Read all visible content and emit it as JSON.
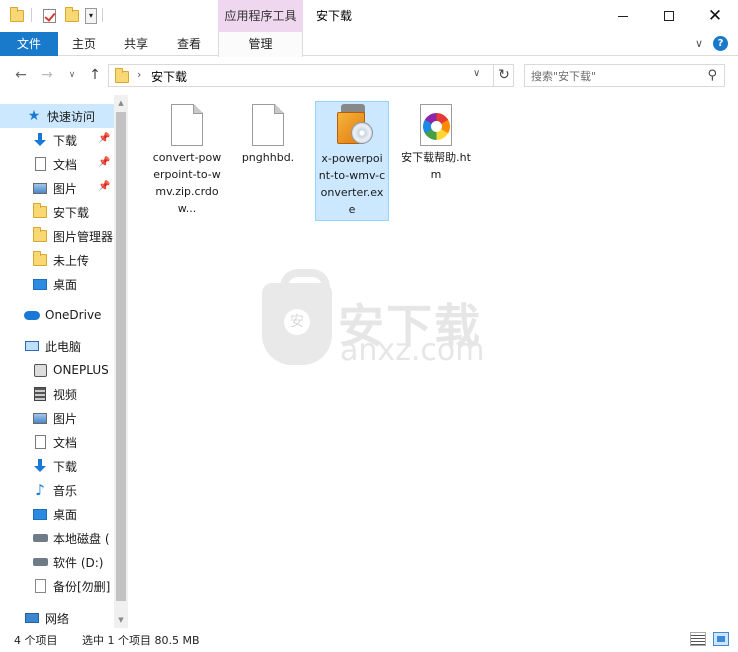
{
  "window": {
    "title": "安下载",
    "contextual_tab_group": "应用程序工具"
  },
  "ribbon": {
    "tabs": [
      {
        "label": "文件"
      },
      {
        "label": "主页"
      },
      {
        "label": "共享"
      },
      {
        "label": "查看"
      },
      {
        "label": "管理"
      }
    ]
  },
  "address": {
    "path": "安下载",
    "search_placeholder": "搜索\"安下载\""
  },
  "nav": {
    "items": [
      {
        "label": "快速访问",
        "icon": "star-icon"
      },
      {
        "label": "下载",
        "icon": "download-icon"
      },
      {
        "label": "文档",
        "icon": "document-icon"
      },
      {
        "label": "图片",
        "icon": "pictures-icon"
      },
      {
        "label": "安下载",
        "icon": "folder-icon"
      },
      {
        "label": "图片管理器",
        "icon": "folder-icon"
      },
      {
        "label": "未上传",
        "icon": "folder-icon"
      },
      {
        "label": "桌面",
        "icon": "desktop-icon"
      },
      {
        "label": "OneDrive",
        "icon": "onedrive-cloud-icon"
      },
      {
        "label": "此电脑",
        "icon": "this-pc-icon"
      },
      {
        "label": "ONEPLUS",
        "icon": "phone-device-icon"
      },
      {
        "label": "视频",
        "icon": "videos-icon"
      },
      {
        "label": "图片",
        "icon": "pictures-icon"
      },
      {
        "label": "文档",
        "icon": "document-icon"
      },
      {
        "label": "下载",
        "icon": "download-icon"
      },
      {
        "label": "音乐",
        "icon": "music-icon"
      },
      {
        "label": "桌面",
        "icon": "desktop-icon"
      },
      {
        "label": "本地磁盘 (",
        "icon": "local-disk-icon"
      },
      {
        "label": "软件 (D:)",
        "icon": "drive-icon"
      },
      {
        "label": "备份[勿删]",
        "icon": "file-icon"
      },
      {
        "label": "网络",
        "icon": "network-icon"
      }
    ]
  },
  "files": [
    {
      "name": "convert-powerpoint-to-wmv.zip.crdow...",
      "icon": "blank-file-icon",
      "selected": false
    },
    {
      "name": "pnghhbd.",
      "icon": "blank-file-icon",
      "selected": false
    },
    {
      "name": "x-powerpoint-to-wmv-converter.exe",
      "icon": "installer-exe-icon",
      "selected": true
    },
    {
      "name": "安下载帮助.htm",
      "icon": "html-file-icon",
      "selected": false
    }
  ],
  "watermark": {
    "title": "安下载",
    "url": "anxz.com",
    "shield_glyph": "安"
  },
  "status": {
    "item_count": "4 个项目",
    "selection": "选中 1 个项目  80.5 MB"
  },
  "colors": {
    "file_tab": "#1979ca",
    "contextual_tab": "#efd8ef",
    "selection": "#cce8ff"
  }
}
